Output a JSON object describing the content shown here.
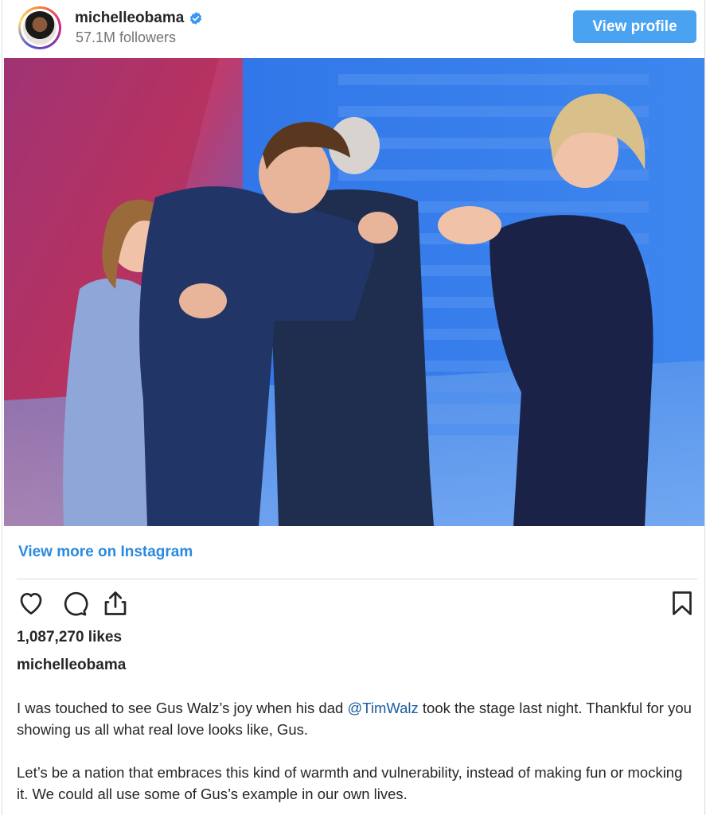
{
  "header": {
    "username": "michelleobama",
    "followers": "57.1M followers",
    "view_profile_label": "View profile",
    "verified_icon": "verified-badge-icon",
    "avatar": "profile-avatar"
  },
  "post": {
    "view_more_label": "View more on Instagram",
    "likes": "1,087,270 likes",
    "caption_username": "michelleobama",
    "caption_p1_before": "I was touched to see Gus Walz’s joy when his dad ",
    "caption_p1_mention": "@TimWalz",
    "caption_p1_after": " took the stage last night. Thankful for you showing us all what real love looks like, Gus.",
    "caption_p2": "Let’s be a nation that embraces this kind of warmth and vulnerability, instead of making fun or mocking it. We could all use some of Gus’s example in our own lives."
  },
  "actions": {
    "like_icon": "heart-icon",
    "comment_icon": "comment-icon",
    "share_icon": "share-icon",
    "save_icon": "bookmark-icon"
  },
  "colors": {
    "button_blue": "#4aa3f0",
    "link_blue": "#2a8ae0",
    "mention_blue": "#1a5aa0",
    "verified_blue": "#3897f0"
  }
}
